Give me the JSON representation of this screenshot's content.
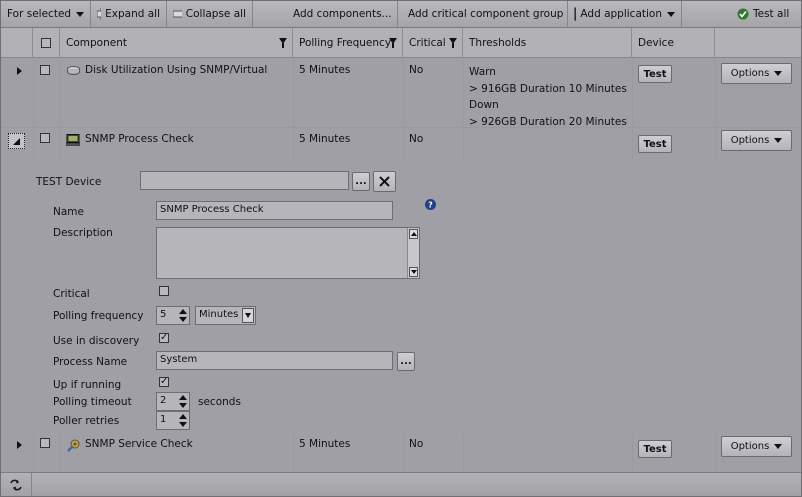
{
  "toolbar": {
    "for_selected": "For selected",
    "expand_all": "Expand all",
    "collapse_all": "Collapse all",
    "add_components": "Add components...",
    "add_critical_group": "Add critical component group",
    "add_application": "Add application",
    "test_all": "Test all"
  },
  "columns": {
    "component": "Component",
    "polling_frequency": "Polling Frequency",
    "critical": "Critical",
    "thresholds": "Thresholds",
    "device": "Device"
  },
  "rows": [
    {
      "component": "Disk Utilization Using SNMP/Virtual",
      "polling": "5 Minutes",
      "critical": "No",
      "thresholds": [
        "Warn",
        "> 916GB Duration 10 Minutes",
        "Down",
        "> 926GB Duration 20 Minutes"
      ],
      "test_label": "Test",
      "options_label": "Options"
    },
    {
      "component": "SNMP Process Check",
      "polling": "5 Minutes",
      "critical": "No",
      "test_label": "Test",
      "options_label": "Options"
    },
    {
      "component": "SNMP Service Check",
      "polling": "5 Minutes",
      "critical": "No",
      "test_label": "Test",
      "options_label": "Options"
    }
  ],
  "detail": {
    "test_device_label": "TEST Device",
    "test_device_value": "",
    "browse_label": "...",
    "name_label": "Name",
    "name_value": "SNMP Process Check",
    "description_label": "Description",
    "description_value": "",
    "critical_label": "Critical",
    "polling_frequency_label": "Polling frequency",
    "polling_frequency_value": "5",
    "polling_frequency_unit": "Minutes",
    "use_in_discovery_label": "Use in discovery",
    "process_name_label": "Process Name",
    "process_name_value": "System",
    "up_if_running_label": "Up if running",
    "polling_timeout_label": "Polling timeout",
    "polling_timeout_value": "2",
    "polling_timeout_unit": "seconds",
    "poller_retries_label": "Poller retries",
    "poller_retries_value": "1"
  },
  "icons": {
    "test_all": "check-circle-icon",
    "help": "help-icon"
  }
}
